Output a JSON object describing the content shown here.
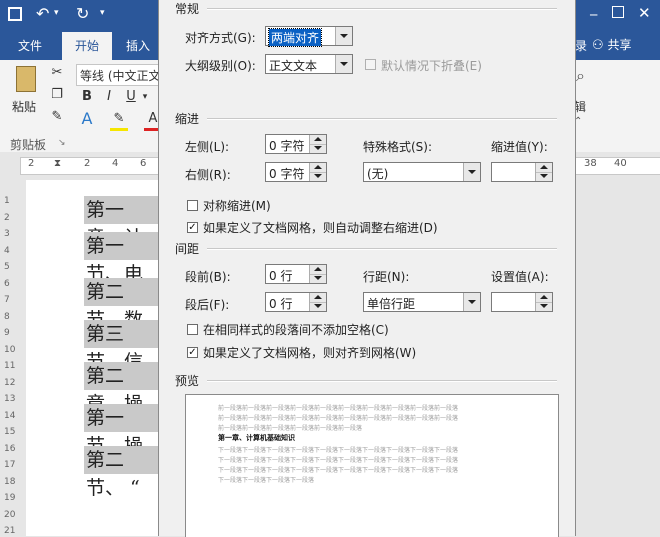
{
  "word": {
    "tabs": [
      "文件",
      "开始",
      "插入"
    ],
    "right_tabs": [
      "录",
      "共享"
    ],
    "ribbon": {
      "paste_label": "粘贴",
      "font_name": "等线 (中文正文",
      "clipboard_group": "剪贴板",
      "bold": "B",
      "italic": "I",
      "underline": "U",
      "right_partial": "辑"
    },
    "ruler_numbers": [
      "2",
      "2",
      "4",
      "6",
      "38",
      "40"
    ],
    "vruler_numbers": [
      "1",
      "2",
      "3",
      "4",
      "5",
      "6",
      "7",
      "8",
      "9",
      "10",
      "11",
      "12",
      "13",
      "14",
      "15",
      "16",
      "17",
      "18",
      "19",
      "20",
      "21"
    ],
    "doc_lines": [
      "第一章、计",
      "第一节、电",
      "第二节、数",
      "第三节、信",
      "第二章、操",
      "第一节、操",
      "第二节、  “"
    ]
  },
  "dialog": {
    "general_title": "常规",
    "alignment_label": "对齐方式(G):",
    "alignment_value": "两端对齐",
    "outline_label": "大纲级别(O):",
    "outline_value": "正文文本",
    "collapse_label": "默认情况下折叠(E)",
    "indent_title": "缩进",
    "left_label": "左侧(L):",
    "left_value": "0 字符",
    "right_label": "右侧(R):",
    "right_value": "0 字符",
    "special_label": "特殊格式(S):",
    "special_value": "(无)",
    "indent_by_label": "缩进值(Y):",
    "mirror_label": "对称缩进(M)",
    "auto_right_label": "如果定义了文档网格，则自动调整右缩进(D)",
    "spacing_title": "间距",
    "before_label": "段前(B):",
    "before_value": "0 行",
    "after_label": "段后(F):",
    "after_value": "0 行",
    "line_spacing_label": "行距(N):",
    "line_spacing_value": "单倍行距",
    "at_label": "设置值(A):",
    "no_space_label": "在相同样式的段落间不添加空格(C)",
    "snap_grid_label": "如果定义了文档网格，则对齐到网格(W)",
    "preview_title": "预览",
    "checks": {
      "mirror": false,
      "auto_right": true,
      "no_space": false,
      "snap_grid": true,
      "collapse": false
    },
    "preview": {
      "gray_line": "前一段落前一段落前一段落前一段落前一段落前一段落前一段落前一段落前一段落前一段落",
      "gray_line_short": "前一段落前一段落前一段落前一段落前一段落前一段落",
      "sample_text": "第一章、计算机基础知识",
      "next_line": "下一段落下一段落下一段落下一段落下一段落下一段落下一段落下一段落下一段落下一段落",
      "next_line_short": "下一段落下一段落下一段落下一段落"
    }
  },
  "colors": {
    "word_blue": "#2b579a",
    "selection_blue": "#0b61c4",
    "doc_highlight": "#c9c9c9"
  }
}
